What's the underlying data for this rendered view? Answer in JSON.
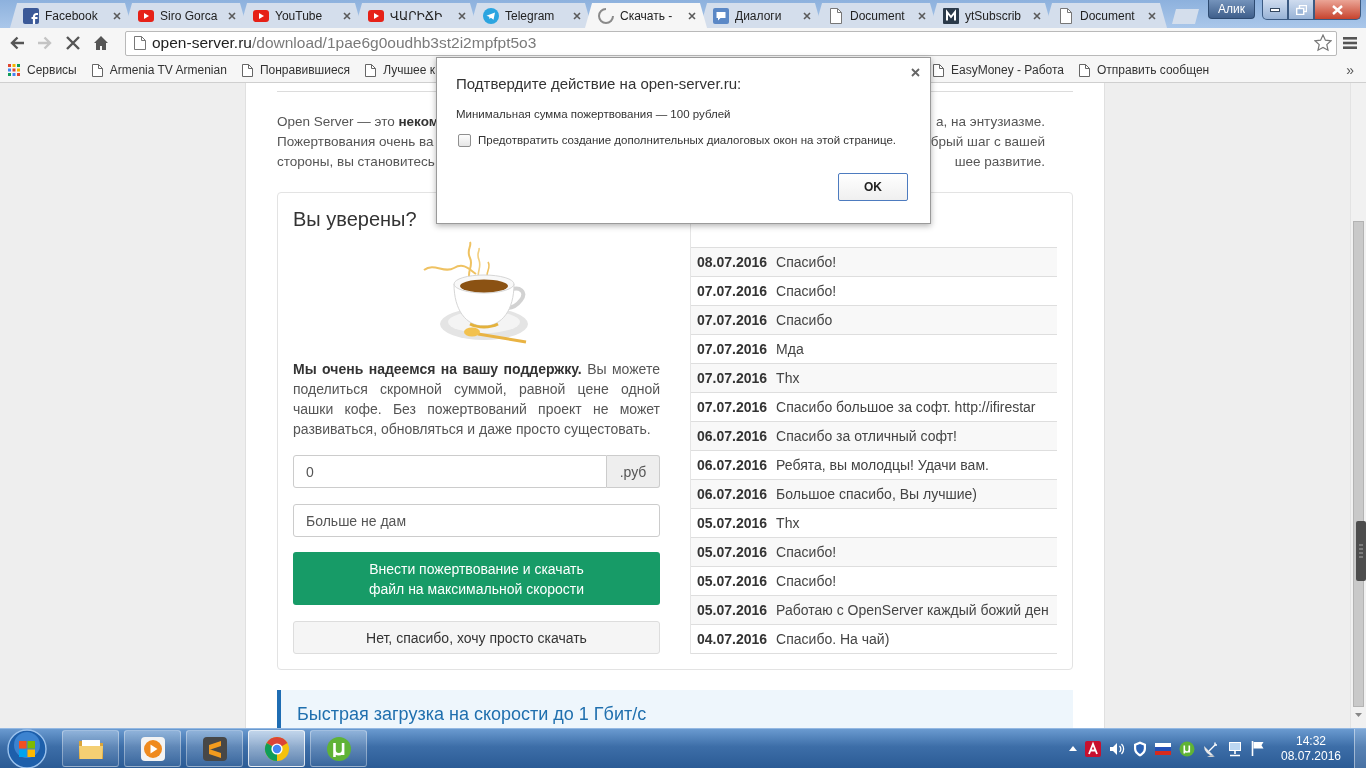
{
  "window": {
    "profile": "Алик"
  },
  "tabs": [
    {
      "kind": "facebook",
      "title": "Facebook",
      "selected": false
    },
    {
      "kind": "video",
      "title": "Siro Gorca",
      "selected": false
    },
    {
      "kind": "video",
      "title": "YouTube",
      "selected": false
    },
    {
      "kind": "video",
      "title": "ՎԱՐԻՃԻ",
      "selected": false
    },
    {
      "kind": "telegram",
      "title": "Telegram",
      "selected": false
    },
    {
      "kind": "loading",
      "title": "Скачать -",
      "selected": true
    },
    {
      "kind": "chat",
      "title": "Диалоги",
      "selected": false
    },
    {
      "kind": "document",
      "title": "Document",
      "selected": false
    },
    {
      "kind": "letter",
      "title": "ytSubscrib",
      "selected": false
    },
    {
      "kind": "document",
      "title": "Document",
      "selected": false
    }
  ],
  "toolbar": {
    "buttons": [
      {
        "kind": "back",
        "disabled": false
      },
      {
        "kind": "forward",
        "disabled": true
      },
      {
        "kind": "stop",
        "disabled": false
      },
      {
        "kind": "home",
        "disabled": false
      }
    ],
    "address": {
      "host": "open-server.ru",
      "path": "/download/1pae6g0oudhb3st2i2mpfpt5o3"
    },
    "starred": false
  },
  "bookmarks": {
    "left": [
      {
        "kind": "apps",
        "label": "Сервисы"
      },
      {
        "kind": "page",
        "label": "Armenia TV Armenian"
      },
      {
        "kind": "page",
        "label": "Понравившиеся"
      },
      {
        "kind": "page",
        "label": "Лучшее к"
      }
    ],
    "right": [
      {
        "kind": "page",
        "label": "EasyMoney - Работа"
      },
      {
        "kind": "page",
        "label": "Отправить сообщен"
      }
    ],
    "overflow": "»"
  },
  "page": {
    "intro_lines": [
      {
        "left": "Open Server — это **неком**",
        "right": "а, на энтузиазме."
      },
      {
        "left": "Пожертвования очень ва",
        "right": "брый шаг с вашей"
      },
      {
        "left": "стороны, вы становитесь",
        "right": "шее развитие."
      }
    ],
    "card": {
      "title": "Вы уверены?",
      "appeal": "**Мы очень надеемся на вашу поддержку.** Вы можете поделиться скромной суммой, равной цене одной чашки кофе. Без пожертвований проект не может развиваться, обновляться и даже просто сущестовать.",
      "amount": {
        "value": "0",
        "unit": ".руб"
      },
      "comment": {
        "value": "Больше не дам"
      },
      "donate_button": "Внести пожертвование и скачать\nфайл на максимальной скорости",
      "skip_button": "Нет, спасибо, хочу просто скачать",
      "donations": [
        {
          "date": "08.07.2016",
          "message": "Спасибо!"
        },
        {
          "date": "07.07.2016",
          "message": "Спасибо!"
        },
        {
          "date": "07.07.2016",
          "message": "Спасибо"
        },
        {
          "date": "07.07.2016",
          "message": "Мда"
        },
        {
          "date": "07.07.2016",
          "message": "Thx"
        },
        {
          "date": "07.07.2016",
          "message": "Спасибо большое за софт. http://ifirestar"
        },
        {
          "date": "06.07.2016",
          "message": "Спасибо за отличный софт!"
        },
        {
          "date": "06.07.2016",
          "message": "Ребята, вы молодцы! Удачи вам."
        },
        {
          "date": "06.07.2016",
          "message": "Большое спасибо, Вы лучшие)"
        },
        {
          "date": "05.07.2016",
          "message": "Thx"
        },
        {
          "date": "05.07.2016",
          "message": "Спасибо!"
        },
        {
          "date": "05.07.2016",
          "message": "Спасибо!"
        },
        {
          "date": "05.07.2016",
          "message": "Работаю с OpenServer каждый божий ден"
        },
        {
          "date": "04.07.2016",
          "message": "Спасибо. На чай)"
        }
      ]
    },
    "feature_heading": "Быстрая загрузка на скорости до 1 Гбит/с"
  },
  "dialog": {
    "title": "Подтвердите действие на open-server.ru:",
    "message": "Минимальная сумма пожертвования — 100 рублей",
    "checkbox": {
      "label": "Предотвратить создание дополнительных диалоговых окон на этой странице.",
      "checked": false
    },
    "button": "OK"
  },
  "taskbar": {
    "apps": [
      {
        "kind": "folder",
        "selected": false
      },
      {
        "kind": "player",
        "selected": false
      },
      {
        "kind": "editor",
        "selected": false
      },
      {
        "kind": "browser",
        "selected": true
      },
      {
        "kind": "torrent",
        "selected": false
      }
    ],
    "tray": [
      {
        "kind": "expand"
      },
      {
        "kind": "pdf"
      },
      {
        "kind": "speaker"
      },
      {
        "kind": "shield"
      },
      {
        "kind": "language"
      },
      {
        "kind": "torrent"
      },
      {
        "kind": "dish"
      },
      {
        "kind": "network"
      },
      {
        "kind": "flag"
      }
    ],
    "time": "14:32",
    "date": "08.07.2016"
  }
}
